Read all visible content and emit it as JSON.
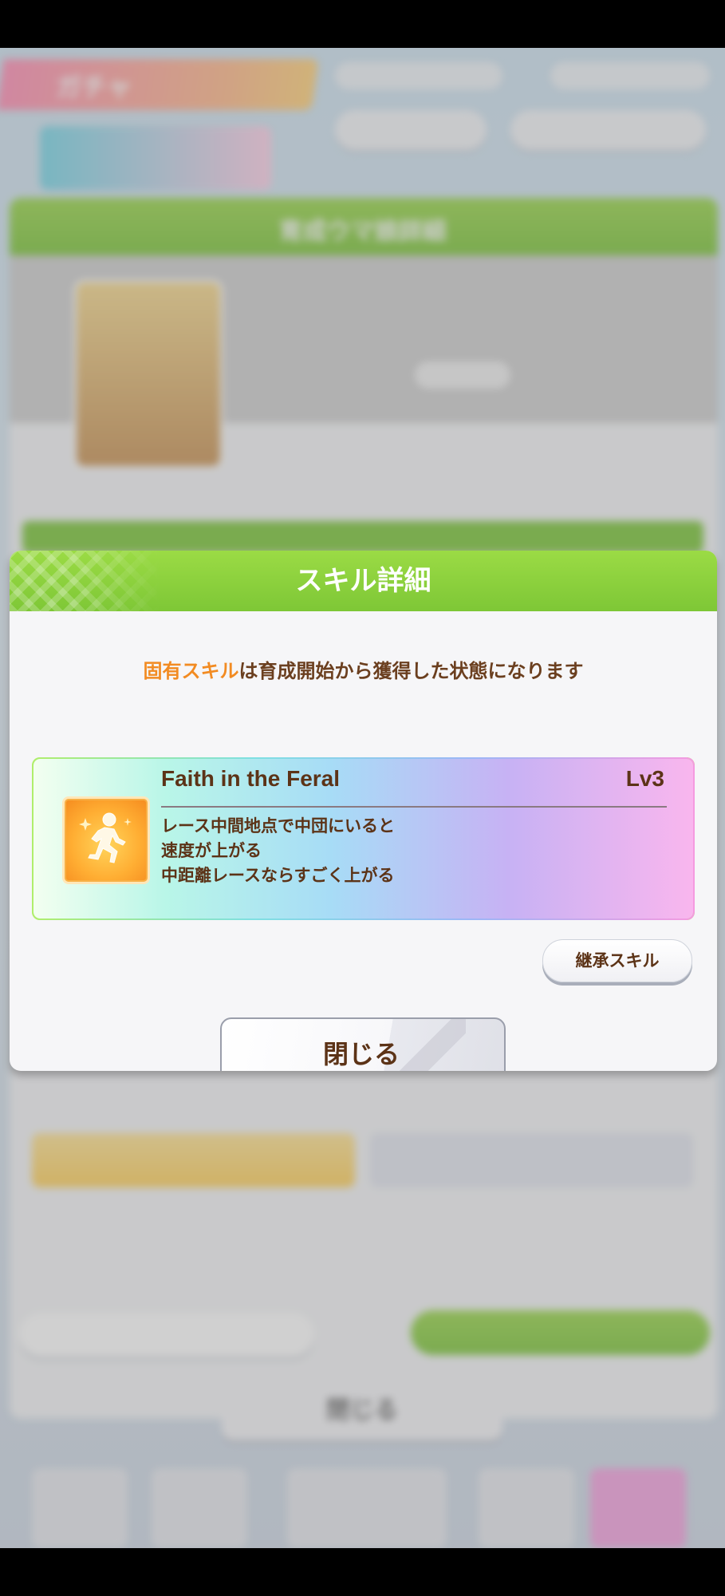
{
  "background": {
    "gacha_title": "ガチャ",
    "panel_title": "育成ウマ娘詳細",
    "close_label": "閉じる"
  },
  "modal": {
    "title": "スキル詳細",
    "notice_highlight": "固有スキル",
    "notice_rest": "は育成開始から獲得した状態になります",
    "skill": {
      "icon": "running-figure-icon",
      "name": "Faith in the Feral",
      "level": "Lv3",
      "description": [
        "レース中間地点で中団にいると",
        "速度が上がる",
        "中距離レースならすごく上がる"
      ]
    },
    "inherit_button_label": "継承スキル",
    "close_button_label": "閉じる"
  },
  "colors": {
    "header_green": "#7ec736",
    "highlight_orange": "#f28b22",
    "text_brown": "#5c3317"
  }
}
